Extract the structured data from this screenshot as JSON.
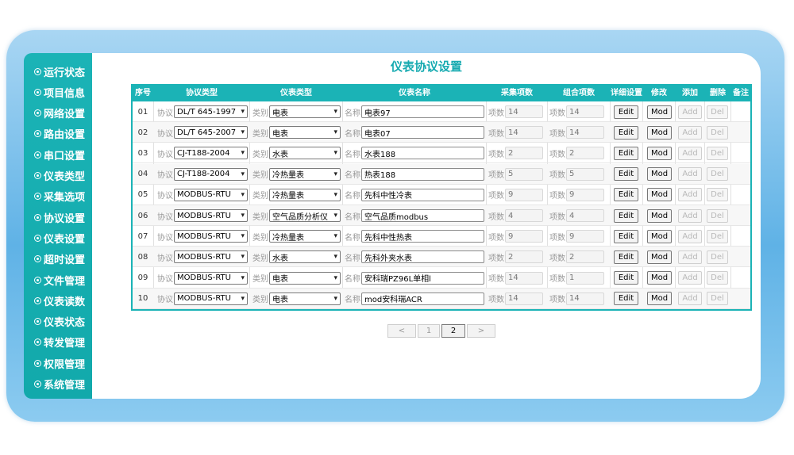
{
  "sidebar": {
    "items": [
      "运行状态",
      "项目信息",
      "网络设置",
      "路由设置",
      "串口设置",
      "仪表类型",
      "采集选项",
      "协议设置",
      "仪表设置",
      "超时设置",
      "文件管理",
      "仪表读数",
      "仪表状态",
      "转发管理",
      "权限管理",
      "系统管理"
    ]
  },
  "page": {
    "title": "仪表协议设置"
  },
  "table": {
    "headers": {
      "index": "序号",
      "protocol": "协议类型",
      "category": "仪表类型",
      "name": "仪表名称",
      "collect": "采集项数",
      "combo": "组合项数",
      "detail": "详细设置",
      "modify": "修改",
      "add": "添加",
      "delete": "删除",
      "note": "备注"
    },
    "labels": {
      "protocol": "协议",
      "category": "类别",
      "name": "名称",
      "items": "项数",
      "edit": "Edit",
      "mod": "Mod",
      "add": "Add",
      "del": "Del"
    },
    "rows": [
      {
        "index": "01",
        "protocol": "DL/T 645-1997",
        "category": "电表",
        "name": "电表97",
        "collect": "14",
        "combo": "14"
      },
      {
        "index": "02",
        "protocol": "DL/T 645-2007",
        "category": "电表",
        "name": "电表07",
        "collect": "14",
        "combo": "14"
      },
      {
        "index": "03",
        "protocol": "CJ-T188-2004",
        "category": "水表",
        "name": "水表188",
        "collect": "2",
        "combo": "2"
      },
      {
        "index": "04",
        "protocol": "CJ-T188-2004",
        "category": "冷热量表",
        "name": "热表188",
        "collect": "5",
        "combo": "5"
      },
      {
        "index": "05",
        "protocol": "MODBUS-RTU",
        "category": "冷热量表",
        "name": "先科中性冷表",
        "collect": "9",
        "combo": "9"
      },
      {
        "index": "06",
        "protocol": "MODBUS-RTU",
        "category": "空气品质分析仪",
        "name": "空气品质modbus",
        "collect": "4",
        "combo": "4"
      },
      {
        "index": "07",
        "protocol": "MODBUS-RTU",
        "category": "冷热量表",
        "name": "先科中性热表",
        "collect": "9",
        "combo": "9"
      },
      {
        "index": "08",
        "protocol": "MODBUS-RTU",
        "category": "水表",
        "name": "先科外夹水表",
        "collect": "2",
        "combo": "2"
      },
      {
        "index": "09",
        "protocol": "MODBUS-RTU",
        "category": "电表",
        "name": "安科瑞PZ96L单相l",
        "collect": "14",
        "combo": "1"
      },
      {
        "index": "10",
        "protocol": "MODBUS-RTU",
        "category": "电表",
        "name": "mod安科瑞ACR",
        "collect": "14",
        "combo": "14"
      }
    ]
  },
  "pager": {
    "prev": "<",
    "pages": [
      "1",
      "2"
    ],
    "next": ">",
    "current": "2"
  },
  "colors": {
    "accent": "#1bb3b6",
    "title": "#15aab0",
    "frame": "#5fb2e6"
  },
  "icons": {
    "sidebar_bullet": "target-bullet-icon",
    "select_arrow": "chevron-down-icon"
  }
}
